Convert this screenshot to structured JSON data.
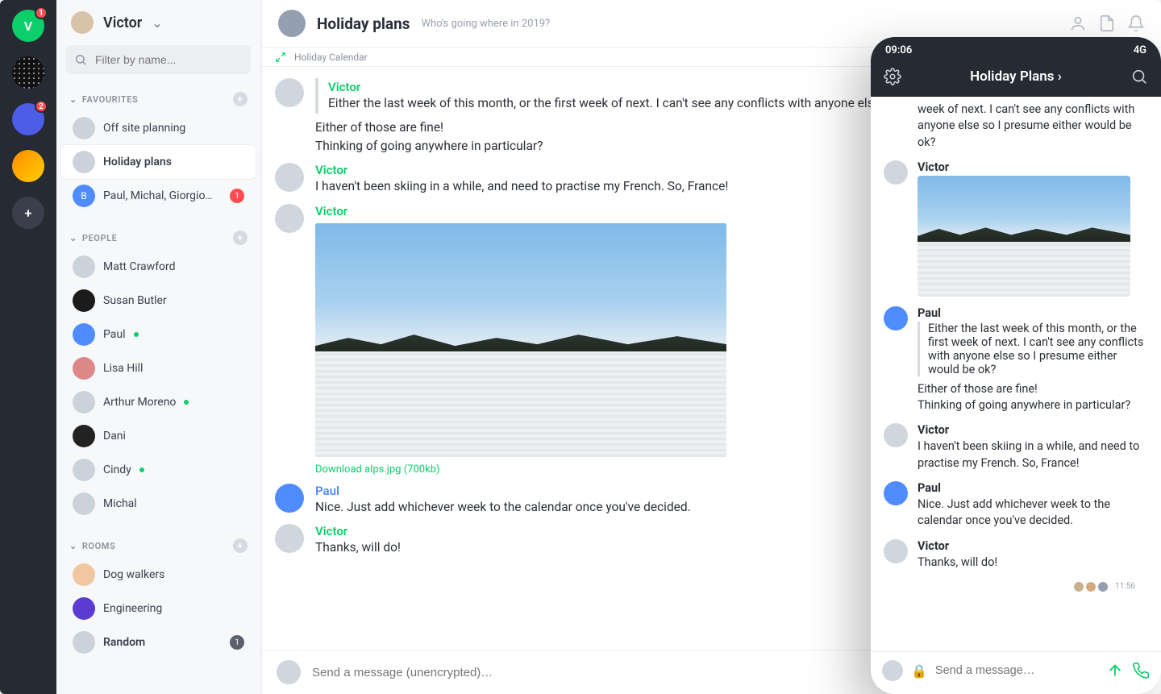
{
  "rail": {
    "servers": [
      {
        "letter": "V",
        "badge": "1"
      },
      {
        "letter": ""
      },
      {
        "letter": "",
        "badge": "2"
      },
      {
        "letter": ""
      }
    ]
  },
  "sidebar": {
    "username": "Victor",
    "filter_placeholder": "Filter by name...",
    "favourites_label": "FAVOURITES",
    "favourites": [
      {
        "label": "Off site planning"
      },
      {
        "label": "Holiday plans"
      },
      {
        "label": "Paul, Michal, Giorgio…",
        "initial": "B",
        "badge": "1"
      }
    ],
    "people_label": "PEOPLE",
    "people": [
      {
        "label": "Matt Crawford"
      },
      {
        "label": "Susan Butler"
      },
      {
        "label": "Paul",
        "online": true
      },
      {
        "label": "Lisa Hill"
      },
      {
        "label": "Arthur Moreno",
        "online": true
      },
      {
        "label": "Dani"
      },
      {
        "label": "Cindy",
        "online": true
      },
      {
        "label": "Michal"
      }
    ],
    "rooms_label": "ROOMS",
    "rooms": [
      {
        "label": "Dog walkers"
      },
      {
        "label": "Engineering"
      },
      {
        "label": "Random",
        "badge": "1"
      }
    ]
  },
  "room": {
    "title": "Holiday plans",
    "topic": "Who's going where in 2019?",
    "apps_label": "Holiday Calendar",
    "download_label": "Download alps.jpg (700kb)",
    "composer_placeholder": "Send a message (unencrypted)…",
    "messages": [
      {
        "author": "Victor",
        "cls": "green",
        "quote": true,
        "text": "Either the last week of this month, or the first week of next. I can't see any conflicts with anyone else so I presume either would be ok?"
      },
      {
        "cls": "",
        "text": "Either of those are fine!",
        "cont": true
      },
      {
        "cls": "",
        "text": "Thinking of going anywhere in particular?",
        "cont": true
      },
      {
        "author": "Victor",
        "cls": "green",
        "text": "I haven't been skiing in a while, and need to practise my French. So, France!"
      },
      {
        "author": "Victor",
        "cls": "green",
        "image": true
      },
      {
        "author": "Paul",
        "cls": "blue",
        "paul": true,
        "text": "Nice. Just add whichever week to the calendar once you've decided."
      },
      {
        "author": "Victor",
        "cls": "green",
        "text": "Thanks, will do!"
      }
    ]
  },
  "phone": {
    "time": "09:06",
    "net": "4G",
    "title": "Holiday Plans",
    "top_fragment": "week of next. I can't see any conflicts with anyone else so I presume either would be ok?",
    "quote": "Either the last week of this month, or the first week of next. I can't see any conflicts with anyone else so I presume either would be ok?",
    "paul_reply1": "Either of those are fine!",
    "paul_reply2": "Thinking of going anywhere in particular?",
    "victor_ski": "I haven't been skiing in a while, and need to practise my French. So, France!",
    "paul_nice": "Nice. Just add whichever week to the calendar once you've decided.",
    "victor_thanks": "Thanks, will do!",
    "rr_time": "11:56",
    "composer_placeholder": "Send a message…",
    "names": {
      "victor": "Victor",
      "paul": "Paul"
    }
  }
}
